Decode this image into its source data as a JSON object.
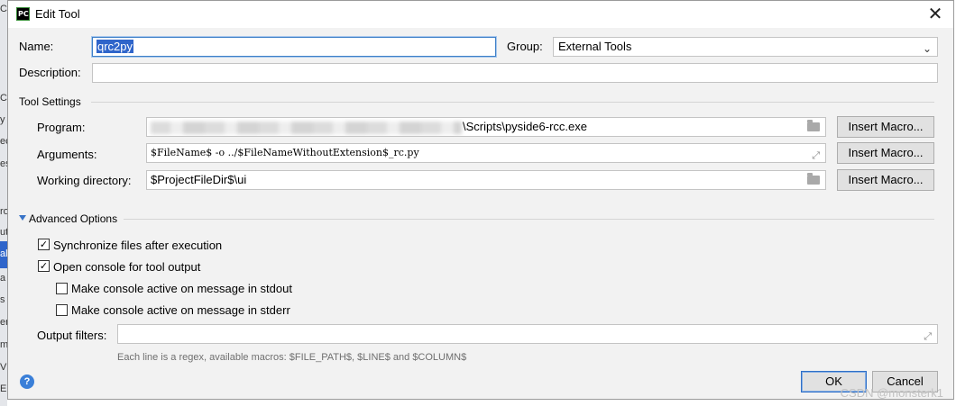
{
  "background_fragments": [
    "C",
    "Co",
    "y",
    "ec",
    "es",
    "ro",
    "ut",
    "al",
    "a",
    "s",
    "er",
    "m",
    "V",
    "E"
  ],
  "window": {
    "title": "Edit Tool",
    "app_icon_text": "PC"
  },
  "name": {
    "label": "Name:",
    "value": "qrc2py"
  },
  "group": {
    "label": "Group:",
    "value": "External Tools"
  },
  "description": {
    "label": "Description:",
    "value": ""
  },
  "tool_settings": {
    "title": "Tool Settings",
    "program": {
      "label": "Program:",
      "value": "\\Scripts\\pyside6-rcc.exe"
    },
    "arguments": {
      "label": "Arguments:",
      "value": "$FileName$ -o ../$FileNameWithoutExtension$_rc.py"
    },
    "working_dir": {
      "label": "Working directory:",
      "value": "$ProjectFileDir$\\ui"
    },
    "insert_macro_label": "Insert Macro..."
  },
  "advanced": {
    "title": "Advanced Options",
    "sync_files": {
      "label": "Synchronize files after execution",
      "checked": true
    },
    "open_console": {
      "label": "Open console for tool output",
      "checked": true
    },
    "active_stdout": {
      "label": "Make console active on message in stdout",
      "checked": false
    },
    "active_stderr": {
      "label": "Make console active on message in stderr",
      "checked": false
    },
    "output_filters": {
      "label": "Output filters:",
      "value": ""
    },
    "hint": "Each line is a regex, available macros: $FILE_PATH$, $LINE$ and $COLUMN$"
  },
  "buttons": {
    "ok": "OK",
    "cancel": "Cancel"
  },
  "watermark": "CSDN @monsterk1",
  "icons": {
    "close": "close-icon",
    "dropdown": "chevron-down-icon",
    "folder": "folder-icon",
    "expand": "expand-icon",
    "help": "help-icon",
    "checkbox_mark": "✓"
  },
  "colors": {
    "accent": "#2f65ca",
    "help": "#3a7fd8",
    "window_bg": "#f2f2f2"
  }
}
